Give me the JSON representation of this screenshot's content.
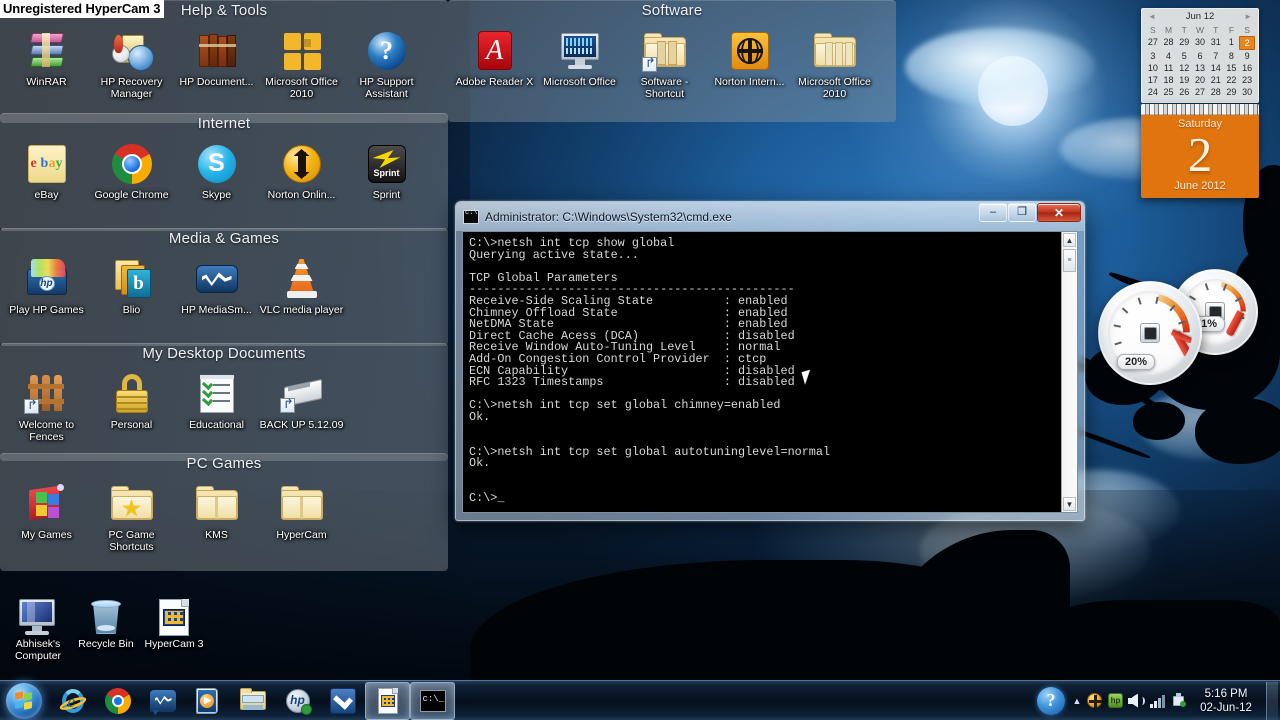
{
  "watermark": {
    "text": "Unregistered HyperCam 3"
  },
  "fences": [
    {
      "title": "Help & Tools",
      "icons": [
        {
          "label": "WinRAR",
          "icon": "winrar-icon"
        },
        {
          "label": "HP Recovery Manager",
          "icon": "hp-recovery-manager-icon"
        },
        {
          "label": "HP Document...",
          "icon": "hp-documentation-icon"
        },
        {
          "label": "Microsoft Office 2010",
          "icon": "microsoft-office-2010-icon"
        },
        {
          "label": "HP Support Assistant",
          "icon": "hp-support-assistant-icon"
        }
      ]
    },
    {
      "title": "Internet",
      "icons": [
        {
          "label": "eBay",
          "icon": "ebay-icon"
        },
        {
          "label": "Google Chrome",
          "icon": "google-chrome-icon"
        },
        {
          "label": "Skype",
          "icon": "skype-icon"
        },
        {
          "label": "Norton Onlin...",
          "icon": "norton-online-backup-icon"
        },
        {
          "label": "Sprint",
          "icon": "sprint-icon"
        }
      ]
    },
    {
      "title": "Media & Games",
      "icons": [
        {
          "label": "Play HP Games",
          "icon": "play-hp-games-icon"
        },
        {
          "label": "Blio",
          "icon": "blio-icon"
        },
        {
          "label": "HP MediaSm...",
          "icon": "hp-mediasmart-icon"
        },
        {
          "label": "VLC media player",
          "icon": "vlc-media-player-icon"
        }
      ]
    },
    {
      "title": "My Desktop Documents",
      "icons": [
        {
          "label": "Welcome to Fences",
          "icon": "welcome-to-fences-icon"
        },
        {
          "label": "Personal",
          "icon": "personal-lock-icon"
        },
        {
          "label": "Educational",
          "icon": "educational-checklist-icon"
        },
        {
          "label": "BACK UP 5.12.09",
          "icon": "backup-drive-icon"
        }
      ]
    },
    {
      "title": "PC Games",
      "icons": [
        {
          "label": "My Games",
          "icon": "my-games-icon"
        },
        {
          "label": "PC Game Shortcuts",
          "icon": "pc-game-shortcuts-folder-icon"
        },
        {
          "label": "KMS",
          "icon": "kms-folder-icon"
        },
        {
          "label": "HyperCam",
          "icon": "hypercam-folder-icon"
        }
      ]
    },
    {
      "title": "Software",
      "icons": [
        {
          "label": "Adobe Reader X",
          "icon": "adobe-reader-x-icon"
        },
        {
          "label": "Microsoft Office",
          "icon": "microsoft-office-icon"
        },
        {
          "label": "Software - Shortcut",
          "icon": "software-shortcut-folder-icon"
        },
        {
          "label": "Norton Intern...",
          "icon": "norton-internet-security-icon"
        },
        {
          "label": "Microsoft Office 2010",
          "icon": "microsoft-office-2010-folder-icon"
        }
      ]
    }
  ],
  "desktop_icons": [
    {
      "label": "Abhisek's Computer",
      "icon": "computer-icon"
    },
    {
      "label": "Recycle Bin",
      "icon": "recycle-bin-icon"
    },
    {
      "label": "HyperCam 3",
      "icon": "hypercam-3-icon"
    }
  ],
  "cmd_window": {
    "title": "Administrator: C:\\Windows\\System32\\cmd.exe",
    "minimize_label": "–",
    "maximize_label": "❐",
    "close_label": "✕",
    "console_text": "C:\\>netsh int tcp show global\nQuerying active state...\n\nTCP Global Parameters\n----------------------------------------------\nReceive-Side Scaling State          : enabled\nChimney Offload State               : enabled\nNetDMA State                        : enabled\nDirect Cache Acess (DCA)            : disabled\nReceive Window Auto-Tuning Level    : normal\nAdd-On Congestion Control Provider  : ctcp\nECN Capability                      : disabled\nRFC 1323 Timestamps                 : disabled\n\nC:\\>netsh int tcp set global chimney=enabled\nOk.\n\n\nC:\\>netsh int tcp set global autotuninglevel=normal\nOk.\n\n\nC:\\>_"
  },
  "calendar_gadget": {
    "month_header": "Jun 12",
    "prev_label": "◄",
    "next_label": "►",
    "day_headers": [
      "S",
      "M",
      "T",
      "W",
      "T",
      "F",
      "S"
    ],
    "weeks": [
      [
        {
          "d": "27",
          "o": true
        },
        {
          "d": "28",
          "o": true
        },
        {
          "d": "29",
          "o": true
        },
        {
          "d": "30",
          "o": true
        },
        {
          "d": "31",
          "o": true
        },
        {
          "d": "1"
        },
        {
          "d": "2",
          "today": true
        }
      ],
      [
        {
          "d": "3"
        },
        {
          "d": "4"
        },
        {
          "d": "5"
        },
        {
          "d": "6"
        },
        {
          "d": "7"
        },
        {
          "d": "8"
        },
        {
          "d": "9"
        }
      ],
      [
        {
          "d": "10"
        },
        {
          "d": "11"
        },
        {
          "d": "12"
        },
        {
          "d": "13"
        },
        {
          "d": "14"
        },
        {
          "d": "15"
        },
        {
          "d": "16"
        }
      ],
      [
        {
          "d": "17"
        },
        {
          "d": "18"
        },
        {
          "d": "19"
        },
        {
          "d": "20"
        },
        {
          "d": "21"
        },
        {
          "d": "22"
        },
        {
          "d": "23"
        }
      ],
      [
        {
          "d": "24"
        },
        {
          "d": "25"
        },
        {
          "d": "26"
        },
        {
          "d": "27"
        },
        {
          "d": "28"
        },
        {
          "d": "29"
        },
        {
          "d": "30"
        }
      ]
    ],
    "weekday": "Saturday",
    "day_number": "2",
    "month_year": "June 2012",
    "accent_color": "#e0750f"
  },
  "meters": [
    {
      "name": "cpu-meter",
      "readout": "20%",
      "value": 20
    },
    {
      "name": "memory-meter",
      "readout": "51%",
      "value": 51
    }
  ],
  "taskbar": {
    "start_label": "Start",
    "items": [
      {
        "icon": "internet-explorer-icon",
        "active": false
      },
      {
        "icon": "google-chrome-icon",
        "active": false
      },
      {
        "icon": "hp-mediasmart-icon",
        "active": false
      },
      {
        "icon": "windows-media-player-icon",
        "active": false
      },
      {
        "icon": "windows-explorer-icon",
        "active": false
      },
      {
        "icon": "hp-icon",
        "active": false
      },
      {
        "icon": "norton-icon",
        "active": false
      },
      {
        "icon": "hypercam-icon",
        "active": true
      },
      {
        "icon": "command-prompt-icon",
        "active": true
      }
    ],
    "tray": {
      "action_center_label": "?",
      "show_hidden_label": "▲",
      "icons": [
        "norton-tray-icon",
        "hp-tray-icon",
        "volume-icon",
        "network-icon",
        "safely-remove-icon"
      ],
      "time": "5:16 PM",
      "date": "02-Jun-12"
    }
  }
}
